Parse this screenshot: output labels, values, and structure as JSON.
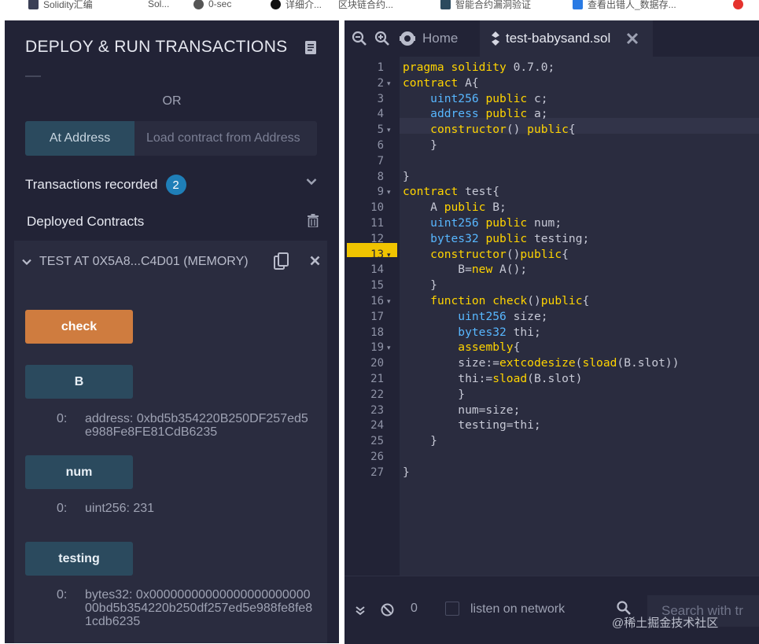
{
  "bookmarks": [
    {
      "label": "Solidity汇编",
      "color": "#3a3f55"
    },
    {
      "label": "Sol...",
      "color": "#333333"
    },
    {
      "label": "0-sec",
      "color": "#555555"
    },
    {
      "label": "详细介...",
      "color": "#111111"
    },
    {
      "label": "区块链合约...",
      "color": "#777777"
    },
    {
      "label": "智能合约漏洞验证",
      "color": "#2b4a5e"
    },
    {
      "label": "查看出错人_数据存...",
      "color": "#2a7be4"
    }
  ],
  "left_panel": {
    "title": "DEPLOY & RUN TRANSACTIONS",
    "or_label": "OR",
    "at_address_button": "At Address",
    "load_address_placeholder": "Load contract from Address",
    "transactions_recorded_label": "Transactions recorded",
    "transactions_recorded_count": "2",
    "deployed_contracts_label": "Deployed Contracts",
    "instance": {
      "title": "TEST AT 0X5A8...C4D01 (MEMORY)",
      "functions": [
        {
          "label": "check",
          "kind": "transact"
        },
        {
          "label": "B",
          "kind": "call",
          "result_index": "0:",
          "result": "address: 0xbd5b354220B250DF257ed5e988Fe8FE81CdB6235"
        },
        {
          "label": "num",
          "kind": "call",
          "result_index": "0:",
          "result": "uint256: 231"
        },
        {
          "label": "testing",
          "kind": "call",
          "result_index": "0:",
          "result": "bytes32: 0x0000000000000000000000000bd5b354220b250df257ed5e988fe8fe81cdb6235"
        }
      ]
    }
  },
  "editor": {
    "home_tab_label": "Home",
    "file_tab_label": "test-babysand.sol",
    "highlighted_line": 13,
    "line_numbers": [
      "1",
      "2",
      "3",
      "4",
      "5",
      "6",
      "7",
      "8",
      "9",
      "10",
      "11",
      "12",
      "13",
      "14",
      "15",
      "16",
      "17",
      "18",
      "19",
      "20",
      "21",
      "22",
      "23",
      "24",
      "25",
      "26",
      "27"
    ],
    "code_lines": [
      "pragma solidity 0.7.0;",
      "contract A{",
      "    uint256 public c;",
      "    address public a;",
      "    constructor() public{",
      "    }",
      "",
      "}",
      "contract test{",
      "    A public B;",
      "    uint256 public num;",
      "    bytes32 public testing;",
      "    constructor()public{",
      "        B=new A();",
      "    }",
      "    function check()public{",
      "        uint256 size;",
      "        bytes32 thi;",
      "        assembly{",
      "        size:=extcodesize(sload(B.slot))",
      "        thi:=sload(B.slot)",
      "        }",
      "        num=size;",
      "        testing=thi;",
      "    }",
      "",
      "}"
    ]
  },
  "terminal": {
    "count": "0",
    "listen_label": "listen on network",
    "search_placeholder": "Search with tr",
    "watermark": "@稀土掘金技术社区"
  },
  "colors": {
    "panel_bg": "#222336",
    "instance_bg": "#2a2c3f",
    "transact_orange": "#cf7c3f",
    "call_blue": "#2b4a5e",
    "keyword_yellow": "#ffd400",
    "type_blue": "#58b7ff",
    "badge_blue": "#1f7fb8"
  }
}
